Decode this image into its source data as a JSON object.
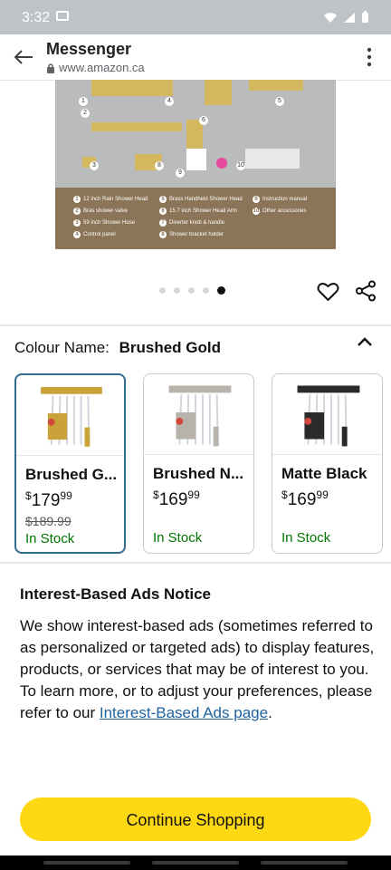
{
  "status_bar": {
    "time": "3:32"
  },
  "browser": {
    "title": "Messenger",
    "url": "www.amazon.ca"
  },
  "product_image": {
    "legend": [
      {
        "n": "1",
        "t": "12 inch Rain Shower Head"
      },
      {
        "n": "2",
        "t": "Bras shower valve"
      },
      {
        "n": "3",
        "t": "59 inch Shower Hose"
      },
      {
        "n": "4",
        "t": "Control panel"
      },
      {
        "n": "5",
        "t": "Brass Handheld Shower Head"
      },
      {
        "n": "6",
        "t": "15.7 inch Shower Head Arm"
      },
      {
        "n": "7",
        "t": "Diverter knob & handle"
      },
      {
        "n": "8",
        "t": "Shower bracket holder"
      },
      {
        "n": "9",
        "t": "Instruction manual"
      },
      {
        "n": "10",
        "t": "Other accessories"
      }
    ],
    "carousel_count": 5,
    "carousel_active": 5
  },
  "colour": {
    "label": "Colour Name:",
    "value": "Brushed Gold"
  },
  "swatches": [
    {
      "name": "Brushed G...",
      "currency": "$",
      "price_whole": "179",
      "price_cents": "99",
      "was": "$189.99",
      "stock": "In Stock",
      "finish_color": "#c9a23a",
      "selected": true
    },
    {
      "name": "Brushed N...",
      "currency": "$",
      "price_whole": "169",
      "price_cents": "99",
      "was": "",
      "stock": "In Stock",
      "finish_color": "#b7b3aa",
      "selected": false
    },
    {
      "name": "Matte Black",
      "currency": "$",
      "price_whole": "169",
      "price_cents": "99",
      "was": "",
      "stock": "In Stock",
      "finish_color": "#2a2a2a",
      "selected": false
    }
  ],
  "notice": {
    "title": "Interest-Based Ads Notice",
    "body": "We show interest-based ads (sometimes referred to as personalized or targeted ads) to display features, products, or services that may be of interest to you. To learn more, or to adjust your preferences, please refer to our ",
    "link": "Interest-Based Ads page",
    "end": "."
  },
  "cta": {
    "label": "Continue Shopping",
    "color": "#ffd814"
  }
}
